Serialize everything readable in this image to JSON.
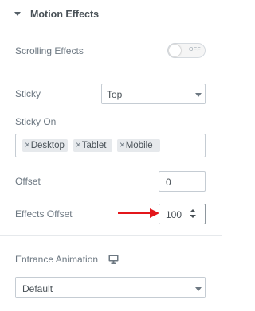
{
  "section": {
    "title": "Motion Effects"
  },
  "scrolling_effects": {
    "label": "Scrolling Effects",
    "toggle_text": "OFF",
    "state": "off"
  },
  "sticky": {
    "label": "Sticky",
    "value": "Top"
  },
  "sticky_on": {
    "label": "Sticky On",
    "tags": [
      "Desktop",
      "Tablet",
      "Mobile"
    ],
    "remove_symbol": "×"
  },
  "offset": {
    "label": "Offset",
    "value": "0"
  },
  "effects_offset": {
    "label": "Effects Offset",
    "value": "100"
  },
  "entrance_animation": {
    "label": "Entrance Animation",
    "value": "Default",
    "icon": "monitor-icon"
  },
  "colors": {
    "annotation_arrow": "#e3161b",
    "text": "#6d7882",
    "heading": "#495157"
  }
}
